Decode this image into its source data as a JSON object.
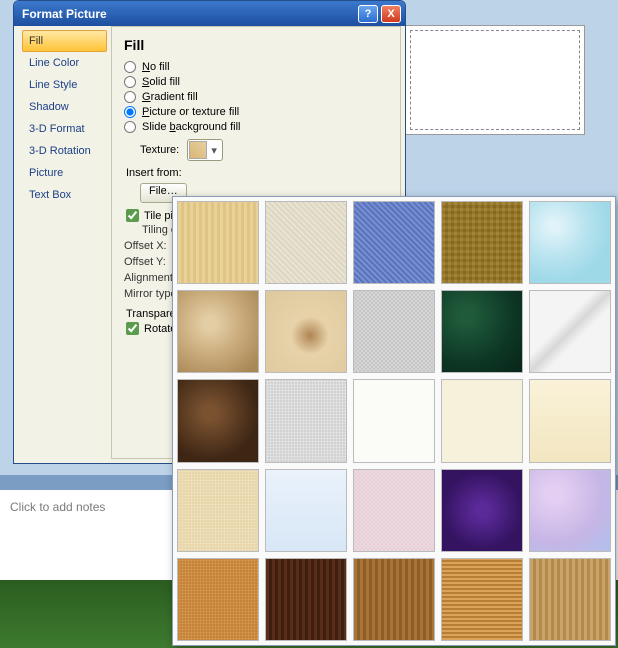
{
  "dialog": {
    "title": "Format Picture",
    "help_tooltip": "?",
    "close_tooltip": "X"
  },
  "sidebar": {
    "items": [
      {
        "label": "Fill",
        "selected": true
      },
      {
        "label": "Line Color"
      },
      {
        "label": "Line Style"
      },
      {
        "label": "Shadow"
      },
      {
        "label": "3-D Format"
      },
      {
        "label": "3-D Rotation"
      },
      {
        "label": "Picture"
      },
      {
        "label": "Text Box"
      }
    ]
  },
  "fill": {
    "heading": "Fill",
    "options": {
      "no_fill": "No fill",
      "solid_fill": "Solid fill",
      "gradient_fill": "Gradient fill",
      "picture_texture_fill": "Picture or texture fill",
      "slide_bg_fill": "Slide background fill"
    },
    "selected": "picture_texture_fill",
    "texture_label": "Texture:",
    "insert_from": "Insert from:",
    "file_button": "File…",
    "tile_checkbox": {
      "label": "Tile picture as texture",
      "checked": true
    },
    "tiling_options_label": "Tiling options",
    "tiling": {
      "offset_x": "Offset X:",
      "offset_y": "Offset Y:",
      "alignment": "Alignment:",
      "mirror": "Mirror type:"
    },
    "transparency_label": "Transparency:",
    "rotate_checkbox": {
      "label": "Rotate with shape",
      "checked": true
    }
  },
  "texture_palette": {
    "textures": [
      "Oak",
      "Canvas",
      "Denim",
      "Woven mat",
      "Water droplets",
      "Paper bag",
      "Fish fossil",
      "Granite",
      "Green marble",
      "White marble",
      "Brown marble",
      "Newsprint",
      "Recycled paper",
      "Parchment",
      "Stationery",
      "Sand",
      "Blue tissue paper",
      "Pink tissue paper",
      "Purple mesh",
      "Bouquet",
      "Cork",
      "Walnut",
      "Medium wood",
      "Oak",
      "Light wood"
    ]
  },
  "notes_placeholder": "Click to add notes"
}
